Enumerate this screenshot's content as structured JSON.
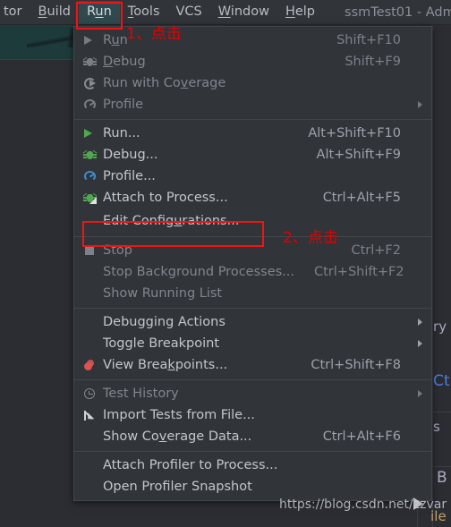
{
  "window": {
    "title": "ssmTest01 - Adm",
    "background_color": "#2b2d33",
    "accent_red": "#e60000"
  },
  "menubar": {
    "items": [
      {
        "label": "tor",
        "mnemonic": "",
        "active": false
      },
      {
        "label": "Build",
        "mnemonic": "B",
        "active": false
      },
      {
        "label": "Run",
        "mnemonic": "R",
        "active": true
      },
      {
        "label": "Tools",
        "mnemonic": "T",
        "active": false
      },
      {
        "label": "VCS",
        "mnemonic": "",
        "active": false
      },
      {
        "label": "Window",
        "mnemonic": "W",
        "active": false
      },
      {
        "label": "Help",
        "mnemonic": "H",
        "active": false
      }
    ],
    "project_title": "ssmTest01 - Adm"
  },
  "annotations": [
    {
      "id": "step-1",
      "text": "1、点击"
    },
    {
      "id": "step-2",
      "text": "2、点击"
    }
  ],
  "menu": {
    "groups": [
      {
        "items": [
          {
            "label": "Run",
            "shortcut": "Shift+F10",
            "icon": "play-icon",
            "disabled": true,
            "submenu": false
          },
          {
            "label": "Debug",
            "shortcut": "Shift+F9",
            "icon": "bug-icon",
            "disabled": true,
            "submenu": false
          },
          {
            "label": "Run with Coverage",
            "shortcut": "",
            "icon": "coverage-icon",
            "disabled": true,
            "submenu": false
          },
          {
            "label": "Profile",
            "shortcut": "",
            "icon": "profile-icon",
            "disabled": true,
            "submenu": true
          }
        ]
      },
      {
        "items": [
          {
            "label": "Run...",
            "shortcut": "Alt+Shift+F10",
            "icon": "play-icon",
            "disabled": false,
            "submenu": false
          },
          {
            "label": "Debug...",
            "shortcut": "Alt+Shift+F9",
            "icon": "bug-icon",
            "disabled": false,
            "submenu": false
          },
          {
            "label": "Profile...",
            "shortcut": "",
            "icon": "profile-icon",
            "disabled": false,
            "submenu": false
          },
          {
            "label": "Attach to Process...",
            "shortcut": "Ctrl+Alt+F5",
            "icon": "attach-process-icon",
            "disabled": false,
            "submenu": false
          },
          {
            "label": "Edit Configurations...",
            "shortcut": "",
            "icon": "none",
            "disabled": false,
            "submenu": false,
            "highlighted": true
          }
        ]
      },
      {
        "items": [
          {
            "label": "Stop",
            "shortcut": "Ctrl+F2",
            "icon": "stop-icon",
            "disabled": true,
            "submenu": false
          },
          {
            "label": "Stop Background Processes...",
            "shortcut": "Ctrl+Shift+F2",
            "icon": "none",
            "disabled": true,
            "submenu": false
          },
          {
            "label": "Show Running List",
            "shortcut": "",
            "icon": "none",
            "disabled": true,
            "submenu": false
          }
        ]
      },
      {
        "items": [
          {
            "label": "Debugging Actions",
            "shortcut": "",
            "icon": "none",
            "disabled": false,
            "submenu": true
          },
          {
            "label": "Toggle Breakpoint",
            "shortcut": "",
            "icon": "none",
            "disabled": false,
            "submenu": true
          },
          {
            "label": "View Breakpoints...",
            "shortcut": "Ctrl+Shift+F8",
            "icon": "breakpoint-icon",
            "disabled": false,
            "submenu": false
          }
        ]
      },
      {
        "items": [
          {
            "label": "Test History",
            "shortcut": "",
            "icon": "clock-icon",
            "disabled": true,
            "submenu": true
          },
          {
            "label": "Import Tests from File...",
            "shortcut": "",
            "icon": "import-icon",
            "disabled": false,
            "submenu": false
          },
          {
            "label": "Show Coverage Data...",
            "shortcut": "Ctrl+Alt+F6",
            "icon": "none",
            "disabled": false,
            "submenu": false
          }
        ]
      },
      {
        "items": [
          {
            "label": "Attach Profiler to Process...",
            "shortcut": "",
            "icon": "none",
            "disabled": false,
            "submenu": false
          },
          {
            "label": "Open Profiler Snapshot",
            "shortcut": "",
            "icon": "none",
            "disabled": false,
            "submenu": false
          }
        ]
      }
    ]
  },
  "background_fragments": [
    {
      "id": "frag-ry",
      "text": "ry",
      "color": "#a8adbd"
    },
    {
      "id": "frag-ct",
      "text": "Ct",
      "color": "#4b7fe0"
    },
    {
      "id": "frag-s",
      "text": "s",
      "color": "#a8adbd"
    },
    {
      "id": "frag-b",
      "text": "B",
      "color": "#a8adbd"
    },
    {
      "id": "frag-ile",
      "text": "ile",
      "color": "#c2a06a"
    }
  ],
  "watermark": {
    "text": "https://blog.csdn.net/zzvar"
  }
}
